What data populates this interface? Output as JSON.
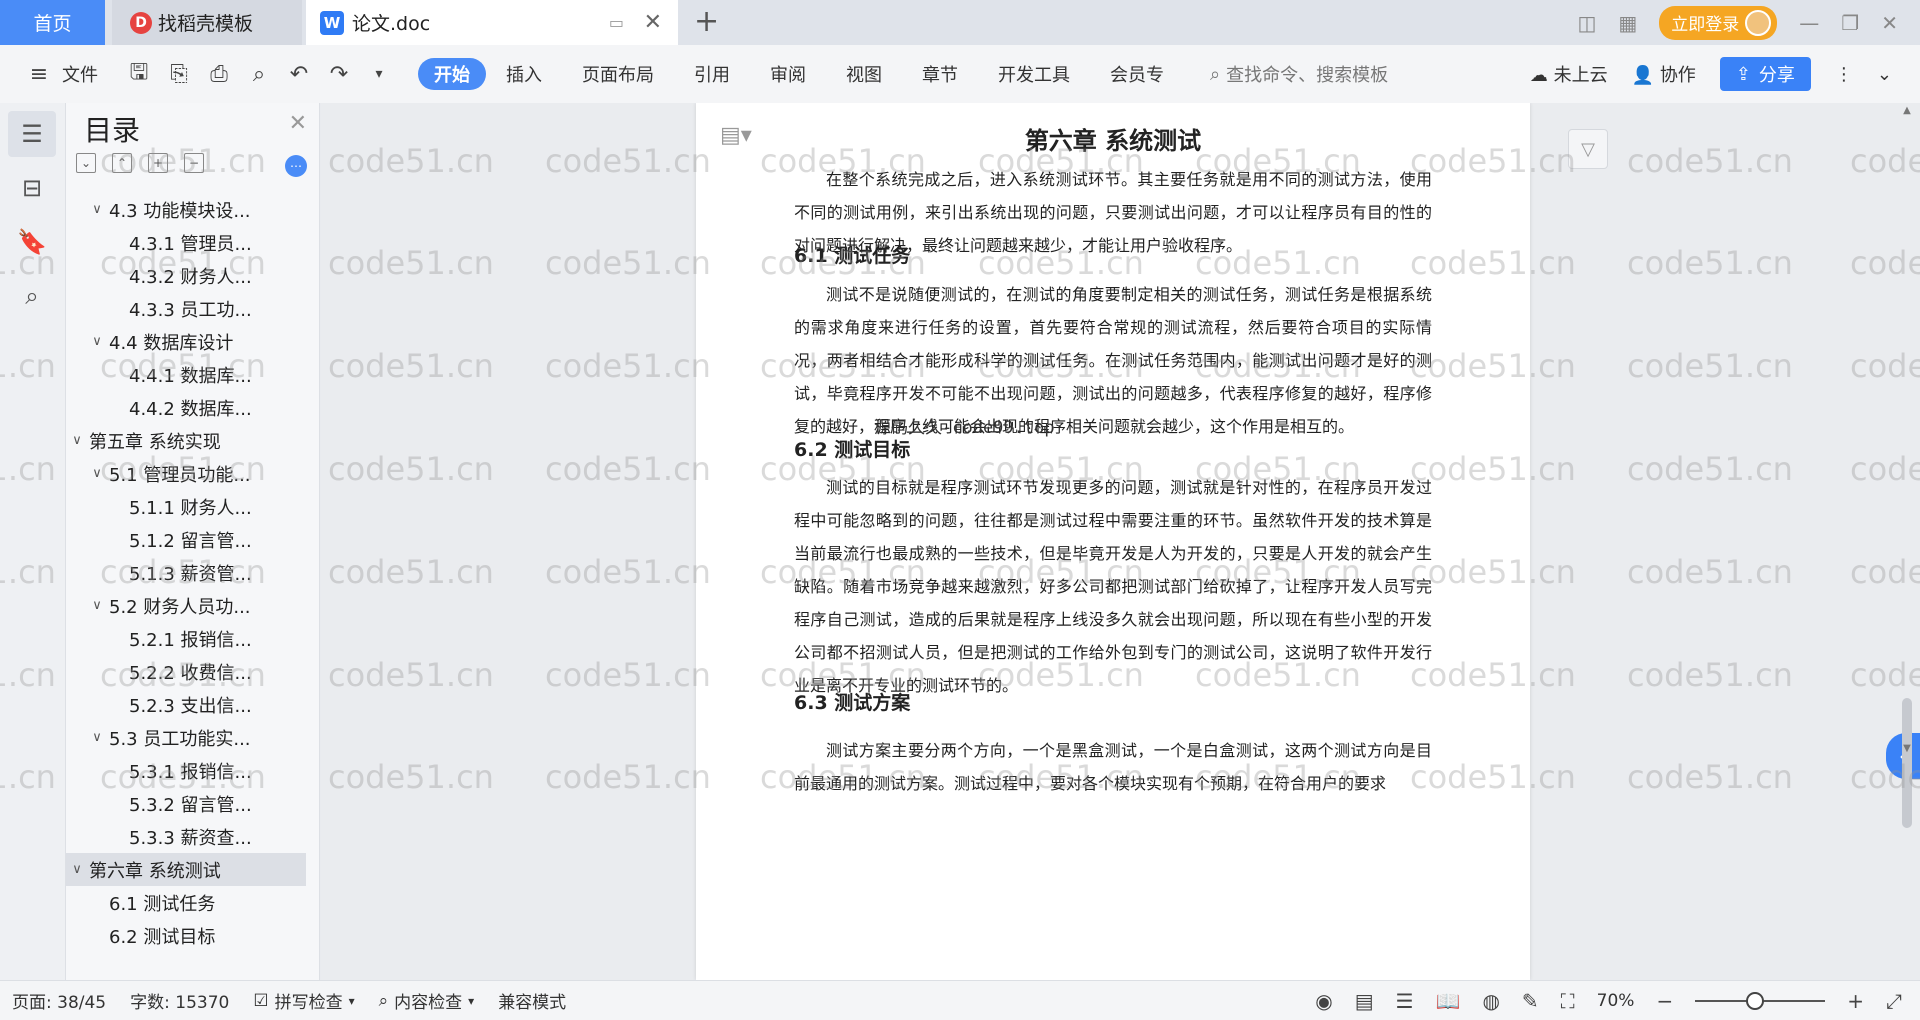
{
  "titlebar": {
    "tabs": {
      "home": "首页",
      "docer": "找稻壳模板",
      "doc": "论文.doc"
    },
    "login_label": "立即登录"
  },
  "menubar": {
    "file_label": "文件",
    "tabs": [
      "开始",
      "插入",
      "页面布局",
      "引用",
      "审阅",
      "视图",
      "章节",
      "开发工具",
      "会员专"
    ],
    "search_placeholder": "查找命令、搜索模板",
    "cloud_label": "未上云",
    "collab_label": "协作",
    "share_label": "分享"
  },
  "toc": {
    "title": "目录",
    "items": [
      {
        "label": "4.3  功能模块设...",
        "level": 2,
        "chevron": true
      },
      {
        "label": "4.3.1  管理员...",
        "level": 3,
        "chevron": false
      },
      {
        "label": "4.3.2  财务人...",
        "level": 3,
        "chevron": false
      },
      {
        "label": "4.3.3  员工功...",
        "level": 3,
        "chevron": false
      },
      {
        "label": "4.4  数据库设计",
        "level": 2,
        "chevron": true
      },
      {
        "label": "4.4.1  数据库...",
        "level": 3,
        "chevron": false
      },
      {
        "label": "4.4.2  数据库...",
        "level": 3,
        "chevron": false
      },
      {
        "label": "第五章  系统实现",
        "level": 1,
        "chevron": true
      },
      {
        "label": "5.1  管理员功能...",
        "level": 2,
        "chevron": true
      },
      {
        "label": "5.1.1  财务人...",
        "level": 3,
        "chevron": false
      },
      {
        "label": "5.1.2  留言管...",
        "level": 3,
        "chevron": false
      },
      {
        "label": "5.1.3  薪资管...",
        "level": 3,
        "chevron": false
      },
      {
        "label": "5.2  财务人员功...",
        "level": 2,
        "chevron": true
      },
      {
        "label": "5.2.1  报销信...",
        "level": 3,
        "chevron": false
      },
      {
        "label": "5.2.2  收费信...",
        "level": 3,
        "chevron": false
      },
      {
        "label": "5.2.3  支出信...",
        "level": 3,
        "chevron": false
      },
      {
        "label": "5.3  员工功能实...",
        "level": 2,
        "chevron": true
      },
      {
        "label": "5.3.1  报销信...",
        "level": 3,
        "chevron": false
      },
      {
        "label": "5.3.2  留言管...",
        "level": 3,
        "chevron": false
      },
      {
        "label": "5.3.3  薪资查...",
        "level": 3,
        "chevron": false
      },
      {
        "label": "第六章  系统测试",
        "level": 1,
        "chevron": true,
        "active": true
      },
      {
        "label": "6.1  测试任务",
        "level": 2,
        "chevron": false
      },
      {
        "label": "6.2  测试目标",
        "level": 2,
        "chevron": false
      }
    ]
  },
  "document": {
    "chapter_title": "第六章  系统测试",
    "intro": "在整个系统完成之后，进入系统测试环节。其主要任务就是用不同的测试方法，使用不同的测试用例，来引出系统出现的问题，只要测试出问题，才可以让程序员有目的性的对问题进行解决，最终让问题越来越少，才能让用户验收程序。",
    "h61": "6.1  测试任务",
    "p61": "测试不是说随便测试的，在测试的角度要制定相关的测试任务，测试任务是根据系统的需求角度来进行任务的设置，首先要符合常规的测试流程，然后要符合项目的实际情况，两者相结合才能形成科学的测试任务。在测试任务范围内，能测试出问题才是好的测试，毕竟程序开发不可能不出现问题，测试出的问题越多，代表程序修复的越好，程序修复的越好，程序上线可能会出现的程序相关问题就会越少，这个作用是相互的。",
    "source_note": "源码久久-code99.top",
    "h62": "6.2  测试目标",
    "p62": "测试的目标就是程序测试环节发现更多的问题，测试就是针对性的，在程序员开发过程中可能忽略到的问题，往往都是测试过程中需要注重的环节。虽然软件开发的技术算是当前最流行也最成熟的一些技术，但是毕竟开发是人为开发的，只要是人开发的就会产生缺陷。随着市场竞争越来越激烈，好多公司都把测试部门给砍掉了，让程序开发人员写完程序自己测试，造成的后果就是程序上线没多久就会出现问题，所以现在有些小型的开发公司都不招测试人员，但是把测试的工作给外包到专门的测试公司，这说明了软件开发行业是离不开专业的测试环节的。",
    "h63": "6.3  测试方案",
    "p63": "测试方案主要分两个方向，一个是黑盒测试，一个是白盒测试，这两个测试方向是目前最通用的测试方案。测试过程中，要对各个模块实现有个预期，在符合用户的要求"
  },
  "watermark": "code51.cn",
  "statusbar": {
    "page": "页面: 38/45",
    "words": "字数: 15370",
    "spell": "拼写检查",
    "content_check": "内容检查",
    "compat": "兼容模式",
    "zoom": "70%",
    "zoom_level": 0.46
  },
  "colors": {
    "accent": "#4a8cf7",
    "login": "#f5a623",
    "share": "#3a82f7"
  }
}
